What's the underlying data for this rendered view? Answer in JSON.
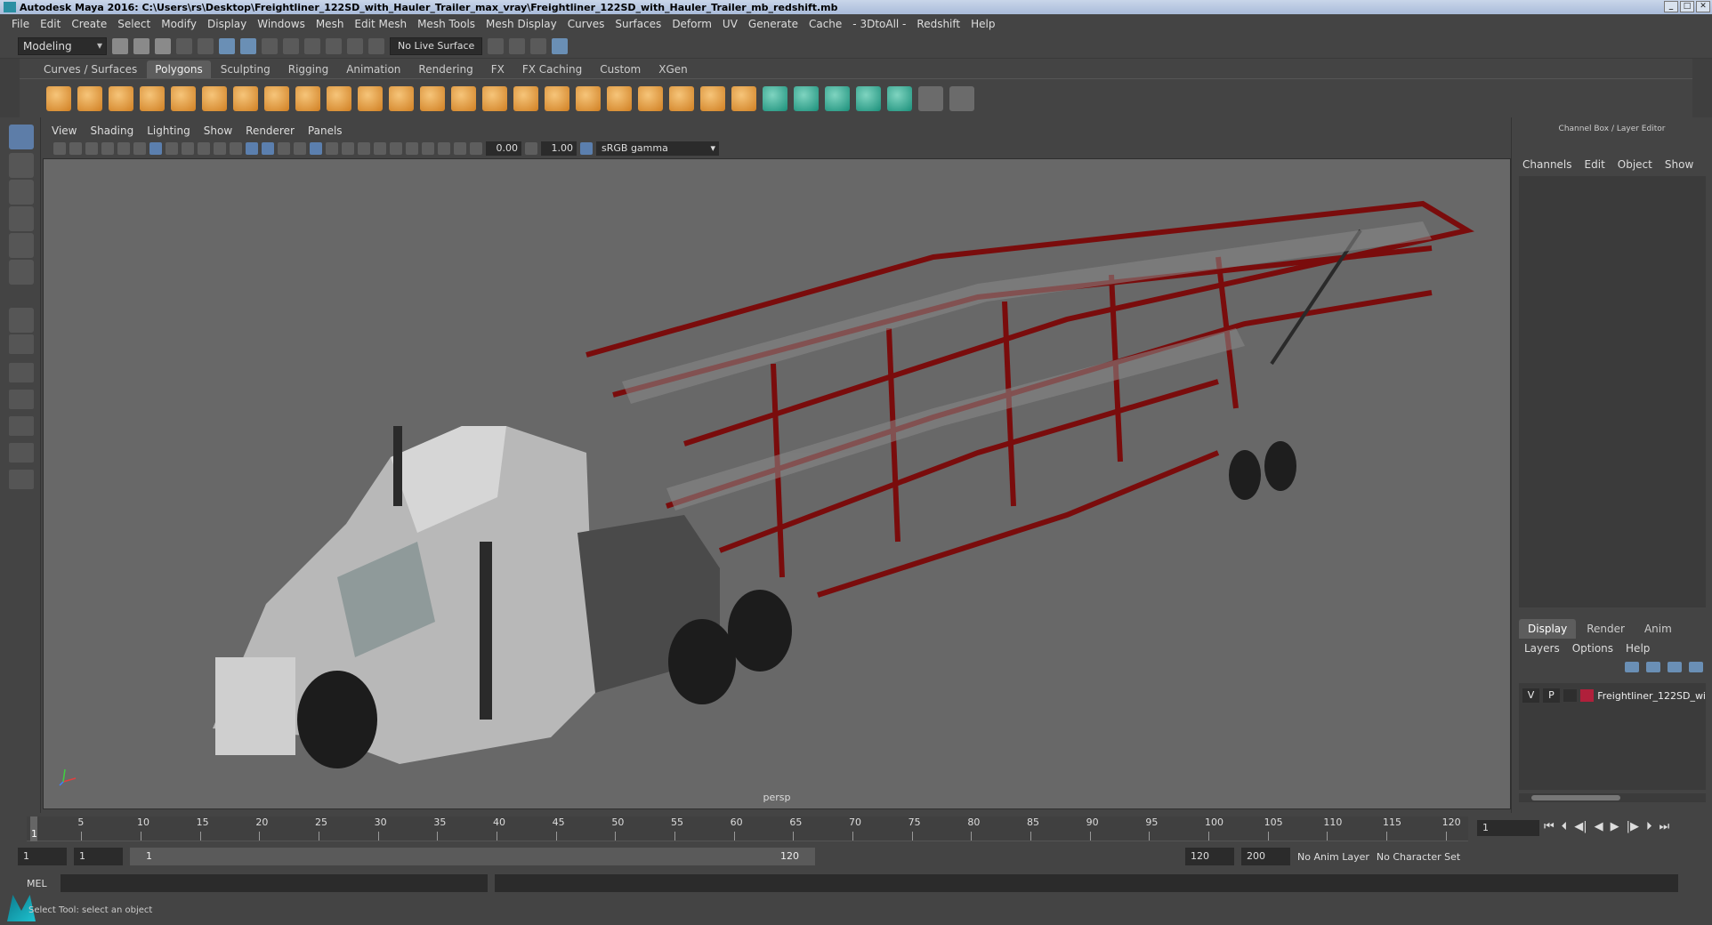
{
  "window": {
    "title": "Autodesk Maya 2016: C:\\Users\\rs\\Desktop\\Freightliner_122SD_with_Hauler_Trailer_max_vray\\Freightliner_122SD_with_Hauler_Trailer_mb_redshift.mb"
  },
  "menu": [
    "File",
    "Edit",
    "Create",
    "Select",
    "Modify",
    "Display",
    "Windows",
    "Mesh",
    "Edit Mesh",
    "Mesh Tools",
    "Mesh Display",
    "Curves",
    "Surfaces",
    "Deform",
    "UV",
    "Generate",
    "Cache",
    "- 3DtoAll -",
    "Redshift",
    "Help"
  ],
  "statusline": {
    "mode": "Modeling",
    "live_surface": "No Live Surface"
  },
  "shelf": {
    "tabs": [
      "Curves / Surfaces",
      "Polygons",
      "Sculpting",
      "Rigging",
      "Animation",
      "Rendering",
      "FX",
      "FX Caching",
      "Custom",
      "XGen"
    ],
    "active_tab": "Polygons"
  },
  "panel": {
    "menu": [
      "View",
      "Shading",
      "Lighting",
      "Show",
      "Renderer",
      "Panels"
    ],
    "exposure": "0.00",
    "gamma_value": "1.00",
    "color_space": "sRGB gamma",
    "camera_label": "persp"
  },
  "channel_box": {
    "title": "Channel Box / Layer Editor",
    "menu": [
      "Channels",
      "Edit",
      "Object",
      "Show"
    ]
  },
  "layer_editor": {
    "tabs": [
      "Display",
      "Render",
      "Anim"
    ],
    "active_tab": "Display",
    "menu": [
      "Layers",
      "Options",
      "Help"
    ],
    "layer": {
      "v": "V",
      "p": "P",
      "name": "Freightliner_122SD_wi",
      "color": "#b0203b"
    }
  },
  "timeslider": {
    "ticks": [
      "5",
      "10",
      "15",
      "20",
      "25",
      "30",
      "35",
      "40",
      "45",
      "50",
      "55",
      "60",
      "65",
      "70",
      "75",
      "80",
      "85",
      "90",
      "95",
      "100",
      "105",
      "110",
      "115",
      "120"
    ],
    "current": "1",
    "current_frame_field": "1"
  },
  "range": {
    "start": "1",
    "playback_start": "1",
    "slider_start": "1",
    "slider_end": "120",
    "playback_end": "120",
    "end": "200",
    "anim_layer": "No Anim Layer",
    "character_set": "No Character Set"
  },
  "command": {
    "mel_label": "MEL"
  },
  "help_line": "Select Tool: select an object"
}
